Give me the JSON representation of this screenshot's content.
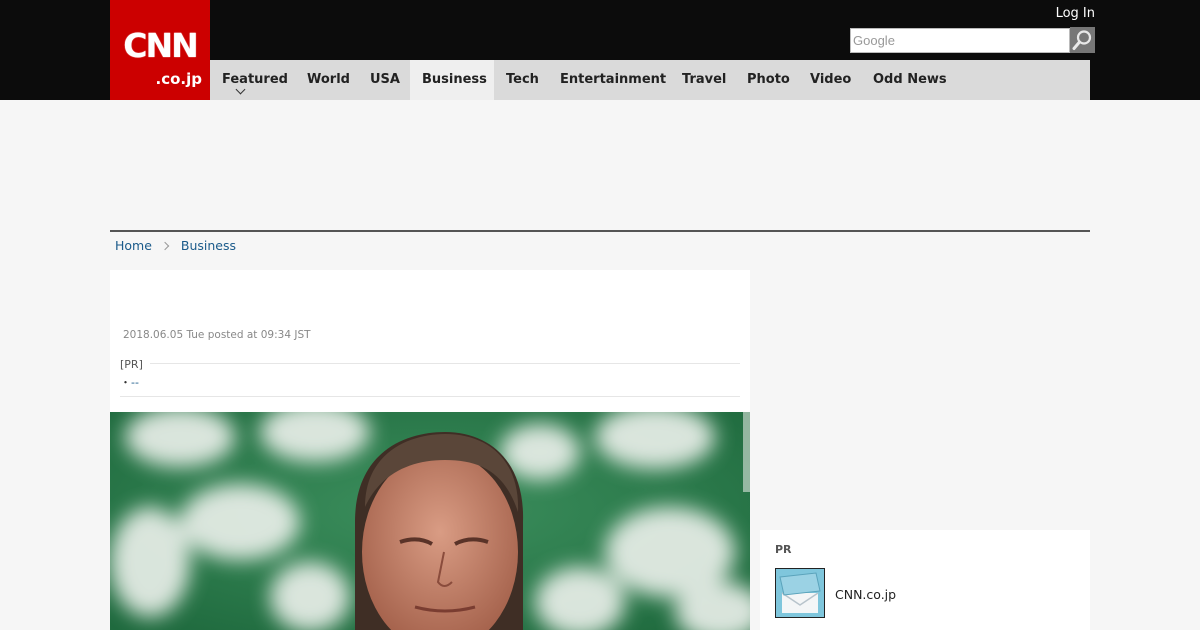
{
  "header": {
    "logo_main": "CNN",
    "logo_sub": ".co.jp",
    "login_label": "Log In",
    "search_placeholder": "Google"
  },
  "nav": {
    "items": [
      {
        "label": "Featured"
      },
      {
        "label": "World"
      },
      {
        "label": "USA"
      },
      {
        "label": "Business"
      },
      {
        "label": "Tech"
      },
      {
        "label": "Entertainment"
      },
      {
        "label": "Travel"
      },
      {
        "label": "Photo"
      },
      {
        "label": "Video"
      },
      {
        "label": "Odd News"
      }
    ],
    "active": "Business"
  },
  "breadcrumb": {
    "home": "Home",
    "current": "Business"
  },
  "article": {
    "posted": "2018.06.05 Tue posted at 09:34 JST",
    "pr_label": "[PR]",
    "pr_bullet": "・",
    "pr_link": "--"
  },
  "sidebar": {
    "pr_title": "PR",
    "pr_item": "CNN.co.jp"
  },
  "colors": {
    "brand_red": "#cc0000",
    "header_bg": "#0c0c0c",
    "nav_bg": "#dadada",
    "link": "#1a5a8a"
  },
  "icons": {
    "search": "magnifier-icon",
    "dropdown": "chevron-down-icon",
    "breadcrumb_separator": "chevron-right-icon"
  }
}
